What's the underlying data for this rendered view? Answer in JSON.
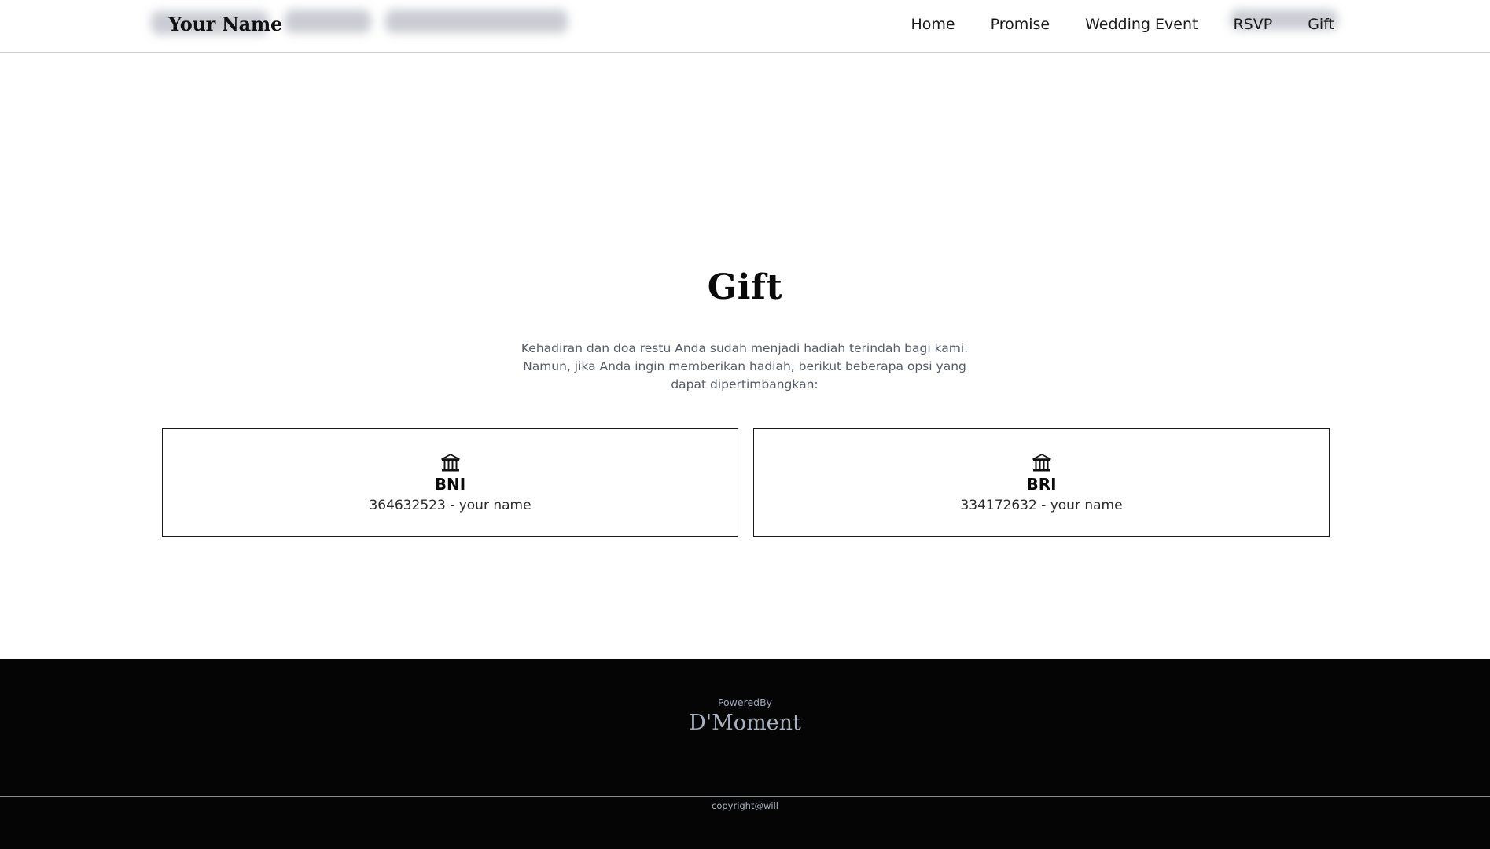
{
  "header": {
    "brand": "Your Name",
    "nav": [
      "Home",
      "Promise",
      "Wedding Event",
      "RSVP",
      "Gift"
    ]
  },
  "gift": {
    "title": "Gift",
    "description": "Kehadiran dan doa restu Anda sudah menjadi hadiah terindah bagi kami. Namun, jika Anda ingin memberikan hadiah, berikut beberapa opsi yang dapat dipertimbangkan:",
    "accounts": [
      {
        "bank": "BNI",
        "account": "364632523 - your name",
        "icon": "bank-icon"
      },
      {
        "bank": "BRI",
        "account": "334172632 - your name",
        "icon": "bank-icon"
      }
    ]
  },
  "footer": {
    "powered_by": "PoweredBy",
    "brand": "D'Moment",
    "copyright": "copyright@will"
  }
}
